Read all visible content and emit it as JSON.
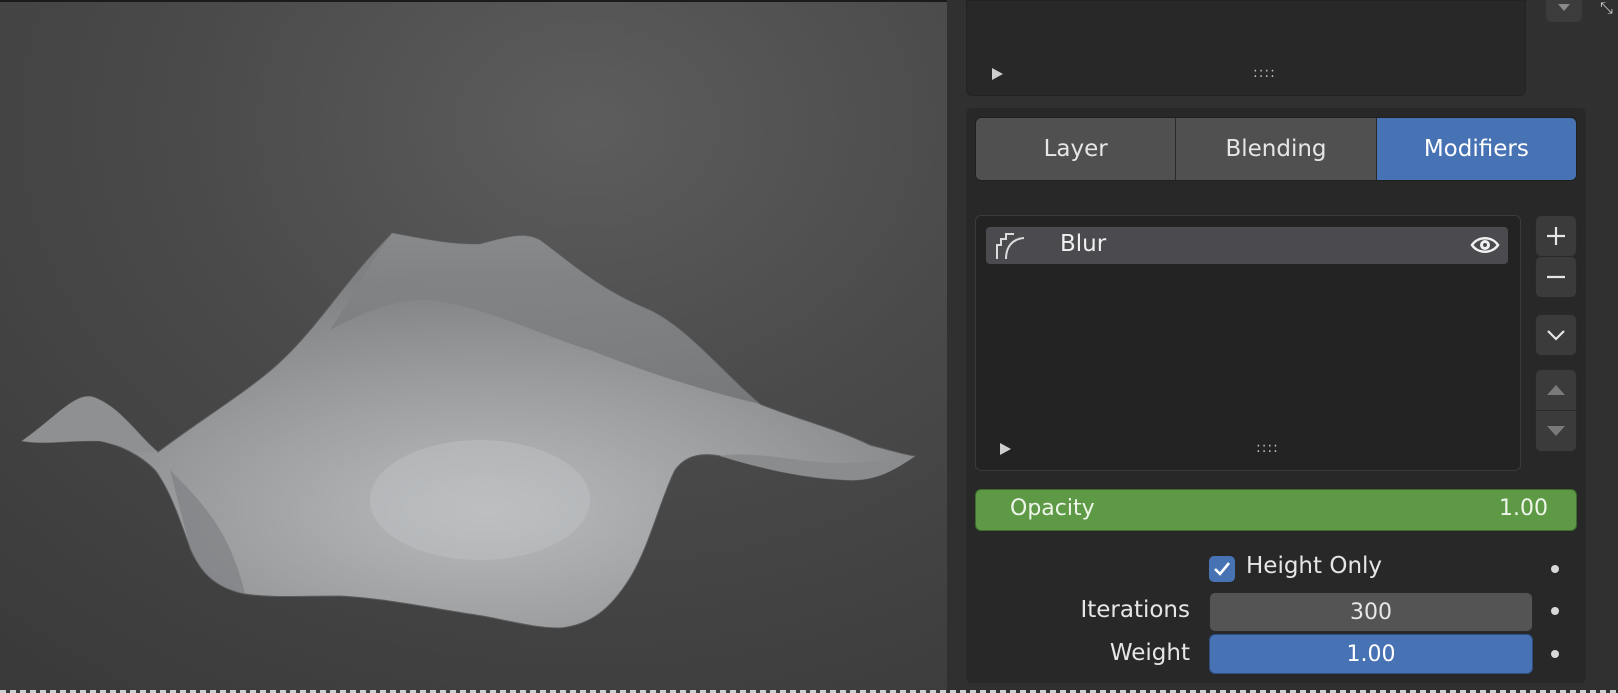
{
  "viewport": {
    "background": "#4a4a4a"
  },
  "top_panel": {
    "grip": "::::"
  },
  "tabs": [
    {
      "label": "Layer",
      "active": false
    },
    {
      "label": "Blending",
      "active": false
    },
    {
      "label": "Modifiers",
      "active": true
    }
  ],
  "modifier_list": {
    "items": [
      {
        "label": "Blur",
        "icon": "blur-modifier-icon",
        "visible": true
      }
    ],
    "grip": "::::"
  },
  "side_buttons": [
    "add-icon",
    "remove-icon",
    "chevron-down-icon",
    "move-up-icon",
    "move-down-icon"
  ],
  "opacity": {
    "label": "Opacity",
    "value": "1.00"
  },
  "height_only": {
    "label": "Height Only",
    "checked": true
  },
  "iterations": {
    "label": "Iterations",
    "value": "300"
  },
  "weight": {
    "label": "Weight",
    "value": "1.00"
  },
  "colors": {
    "accent": "#4772b3",
    "opacity_bar": "#5e9a45"
  }
}
